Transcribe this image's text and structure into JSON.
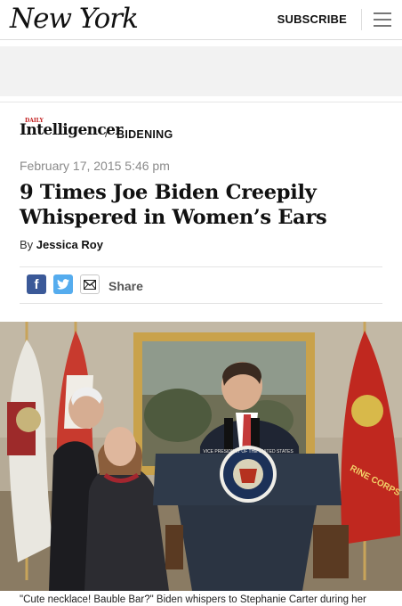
{
  "header": {
    "logo_text": "New York",
    "subscribe_label": "SUBSCRIBE",
    "menu_icon": "hamburger-icon"
  },
  "article": {
    "rubric": {
      "brand_small": "DAILY",
      "brand": "Intelligencer",
      "separator": "/",
      "section": "BIDENING"
    },
    "date": "February 17, 2015 5:46 pm",
    "headline": "9 Times Joe Biden Creepily Whispered in Women’s Ears",
    "byline_prefix": "By",
    "author": "Jessica Roy",
    "share": {
      "facebook_glyph": "f",
      "twitter_glyph": "t",
      "share_label": "Share"
    },
    "photo": {
      "seal_text": "VICE PRESIDENT OF THE UNITED STATES",
      "flag_text": "RINE CORPS"
    },
    "caption": "\"Cute necklace! Bauble Bar?\" Biden whispers to Stephanie Carter during her"
  },
  "colors": {
    "facebook": "#3b5998",
    "twitter": "#55acee",
    "brand_red": "#c01818"
  }
}
